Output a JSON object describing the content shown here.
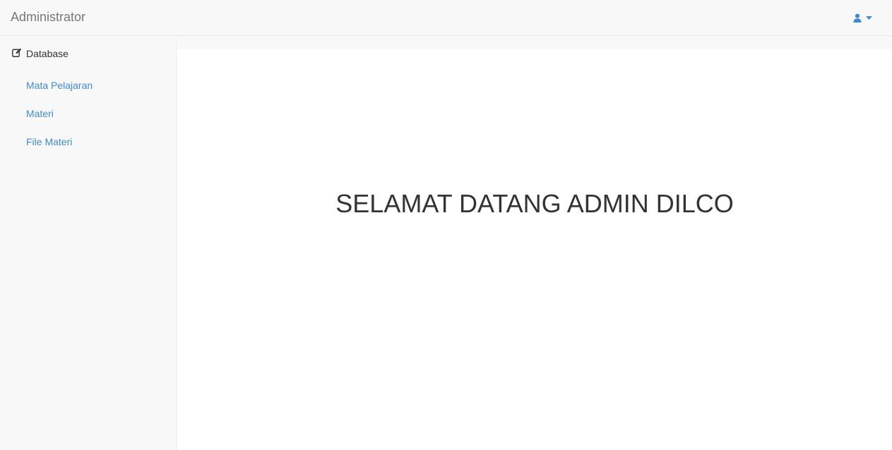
{
  "navbar": {
    "brand": "Administrator",
    "user_icon": "user-icon",
    "caret_icon": "caret-down-icon",
    "accent_color": "#428bca"
  },
  "sidebar": {
    "header_icon": "edit-icon",
    "header_label": "Database",
    "items": [
      {
        "label": "Mata Pelajaran"
      },
      {
        "label": "Materi"
      },
      {
        "label": "File Materi"
      }
    ]
  },
  "main": {
    "welcome": "SELAMAT DATANG ADMIN DILCO"
  }
}
